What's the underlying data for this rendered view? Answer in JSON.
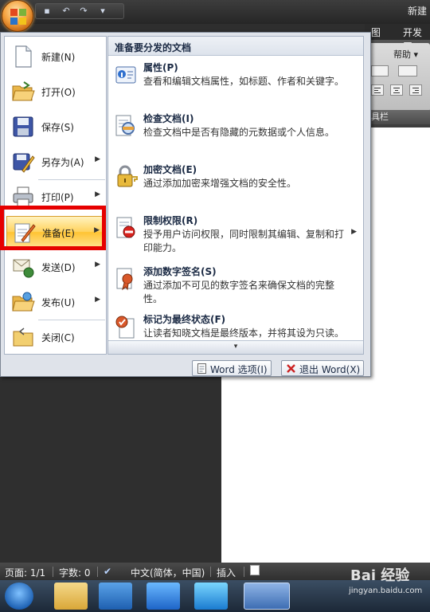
{
  "window": {
    "title": "新建",
    "ribbon_tabs": [
      "图",
      "开发工"
    ],
    "help_dropdown": "帮助",
    "group_label": "具栏"
  },
  "office_menu": {
    "left_items": [
      {
        "label": "新建(N)",
        "icon": "new-document-icon",
        "submenu": false
      },
      {
        "label": "打开(O)",
        "icon": "open-folder-icon",
        "submenu": false
      },
      {
        "label": "保存(S)",
        "icon": "save-disk-icon",
        "submenu": false
      },
      {
        "label": "另存为(A)",
        "icon": "save-as-icon",
        "submenu": true
      },
      {
        "label": "打印(P)",
        "icon": "printer-icon",
        "submenu": true
      },
      {
        "label": "准备(E)",
        "icon": "prepare-icon",
        "submenu": true,
        "selected": true
      },
      {
        "label": "发送(D)",
        "icon": "send-icon",
        "submenu": true
      },
      {
        "label": "发布(U)",
        "icon": "publish-icon",
        "submenu": true
      },
      {
        "label": "关闭(C)",
        "icon": "close-folder-icon",
        "submenu": false
      }
    ],
    "panel_title": "准备要分发的文档",
    "panel_items": [
      {
        "title": "属性(P)",
        "desc": "查看和编辑文档属性，如标题、作者和关键字。",
        "icon": "properties-icon"
      },
      {
        "title": "检查文档(I)",
        "desc": "检查文档中是否有隐藏的元数据或个人信息。",
        "icon": "inspect-document-icon"
      },
      {
        "title": "加密文档(E)",
        "desc": "通过添加加密来增强文档的安全性。",
        "icon": "encrypt-lock-icon"
      },
      {
        "title": "限制权限(R)",
        "desc": "授予用户访问权限，同时限制其编辑、复制和打印能力。",
        "icon": "restrict-permission-icon",
        "submenu": true
      },
      {
        "title": "添加数字签名(S)",
        "desc": "通过添加不可见的数字签名来确保文档的完整性。",
        "icon": "digital-signature-icon"
      },
      {
        "title": "标记为最终状态(F)",
        "desc": "让读者知晓文档是最终版本，并将其设为只读。",
        "icon": "mark-final-icon"
      }
    ],
    "word_options_label": "Word 选项(I)",
    "exit_word_label": "退出 Word(X)"
  },
  "statusbar": {
    "page": "页面: 1/1",
    "words": "字数: 0",
    "language": "中文(简体，中国)",
    "mode": "插入"
  },
  "watermark": {
    "brand": "Bai 经验",
    "url": "jingyan.baidu.com"
  }
}
